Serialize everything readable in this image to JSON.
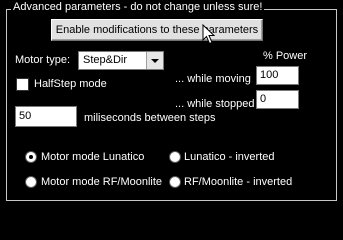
{
  "group": {
    "legend": "Advanced parameters - do not change unless sure!",
    "enable_button_label": "Enable modifications to these parameters"
  },
  "motor": {
    "type_label": "Motor type:",
    "type_value": "Step&Dir"
  },
  "power": {
    "header": "% Power",
    "moving_label": "... while moving",
    "moving_value": "100",
    "stopped_label": "... while stopped",
    "stopped_value": "0"
  },
  "halfstep": {
    "label": "HalfStep mode",
    "checked": false
  },
  "delay": {
    "value": "50",
    "label": "miliseconds between steps"
  },
  "modes": [
    {
      "label": "Motor mode Lunatico",
      "selected": true
    },
    {
      "label": "Lunatico - inverted",
      "selected": false
    },
    {
      "label": "Motor mode RF/Moonlite",
      "selected": false
    },
    {
      "label": "RF/Moonlite - inverted",
      "selected": false
    }
  ]
}
